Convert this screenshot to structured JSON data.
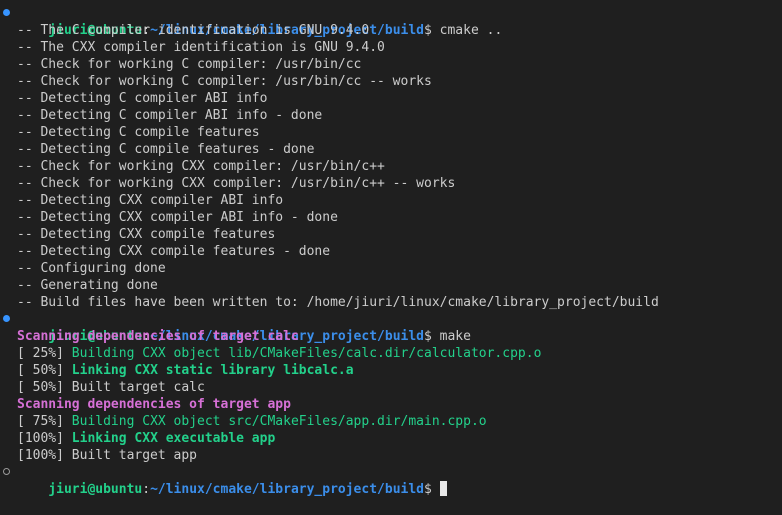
{
  "prompt": {
    "user_host": "jiuri@ubuntu",
    "colon": ":",
    "path": "~/linux/cmake/library_project/build",
    "dollar": "$ "
  },
  "commands": {
    "first": "cmake ..",
    "second": "make"
  },
  "cmake_output": [
    "-- The C compiler identification is GNU 9.4.0",
    "-- The CXX compiler identification is GNU 9.4.0",
    "-- Check for working C compiler: /usr/bin/cc",
    "-- Check for working C compiler: /usr/bin/cc -- works",
    "-- Detecting C compiler ABI info",
    "-- Detecting C compiler ABI info - done",
    "-- Detecting C compile features",
    "-- Detecting C compile features - done",
    "-- Check for working CXX compiler: /usr/bin/c++",
    "-- Check for working CXX compiler: /usr/bin/c++ -- works",
    "-- Detecting CXX compiler ABI info",
    "-- Detecting CXX compiler ABI info - done",
    "-- Detecting CXX compile features",
    "-- Detecting CXX compile features - done",
    "-- Configuring done",
    "-- Generating done",
    "-- Build files have been written to: /home/jiuri/linux/cmake/library_project/build"
  ],
  "make_output": {
    "scan_calc": "Scanning dependencies of target calc",
    "calc_build": {
      "pct": "[ 25%] ",
      "text": "Building CXX object lib/CMakeFiles/calc.dir/calculator.cpp.o"
    },
    "calc_link": {
      "pct": "[ 50%] ",
      "text": "Linking CXX static library libcalc.a"
    },
    "calc_built": "[ 50%] Built target calc",
    "scan_app": "Scanning dependencies of target app",
    "app_build": {
      "pct": "[ 75%] ",
      "text": "Building CXX object src/CMakeFiles/app.dir/main.cpp.o"
    },
    "app_link": {
      "pct": "[100%] ",
      "text": "Linking CXX executable app"
    },
    "app_built": "[100%] Built target app"
  },
  "icons": {
    "command_done_marker": "filled-circle",
    "current_prompt_marker": "hollow-circle"
  },
  "colors": {
    "background": "#1f1f1f",
    "text": "#cccccc",
    "user_host": "#23d18b",
    "path": "#3b8eea",
    "scanning": "#d670d6",
    "building": "#23d18b",
    "marker": "#3794ff"
  }
}
